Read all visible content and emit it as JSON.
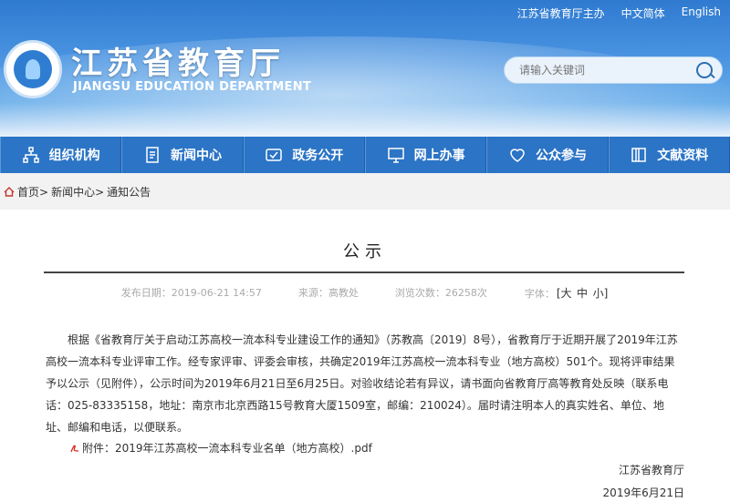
{
  "header": {
    "top_links": [
      "江苏省教育厅主办",
      "中文简体",
      "English"
    ],
    "title_cn": "江苏省教育厅",
    "title_en": "JIANGSU EDUCATION DEPARTMENT",
    "search_placeholder": "请输入关键词"
  },
  "nav": {
    "items": [
      {
        "label": "组织机构",
        "icon": "org-chart-icon"
      },
      {
        "label": "新闻中心",
        "icon": "document-icon"
      },
      {
        "label": "政务公开",
        "icon": "public-affairs-icon"
      },
      {
        "label": "网上办事",
        "icon": "monitor-icon"
      },
      {
        "label": "公众参与",
        "icon": "heart-icon"
      },
      {
        "label": "文献资料",
        "icon": "bookshelf-icon"
      }
    ]
  },
  "breadcrumb": [
    "首页>",
    "新闻中心>",
    "通知公告"
  ],
  "article": {
    "title": "公示",
    "publish_date": "发布日期：2019-06-21 14:57",
    "source": "来源：高教处",
    "views": "浏览次数：26258次",
    "font_size_label": "字体：",
    "font_sizes": [
      "[大",
      "中",
      "小]"
    ],
    "body": "根据《省教育厅关于启动江苏高校一流本科专业建设工作的通知》（苏教高〔2019〕8号），省教育厅于近期开展了2019年江苏高校一流本科专业评审工作。经专家评审、评委会审核，共确定2019年江苏高校一流本科专业（地方高校）501个。现将评审结果予以公示（见附件），公示时间为2019年6月21日至6月25日。对验收结论若有异议，请书面向省教育厅高等教育处反映（联系电话：025-83335158，地址：南京市北京西路15号教育大厦1509室，邮编：210024）。届时请注明本人的真实姓名、单位、地址、邮编和电话，以便联系。",
    "attachment": "附件：2019年江苏高校一流本科专业名单（地方高校）.pdf",
    "signature": "江苏省教育厅",
    "sign_date": "2019年6月21日"
  }
}
